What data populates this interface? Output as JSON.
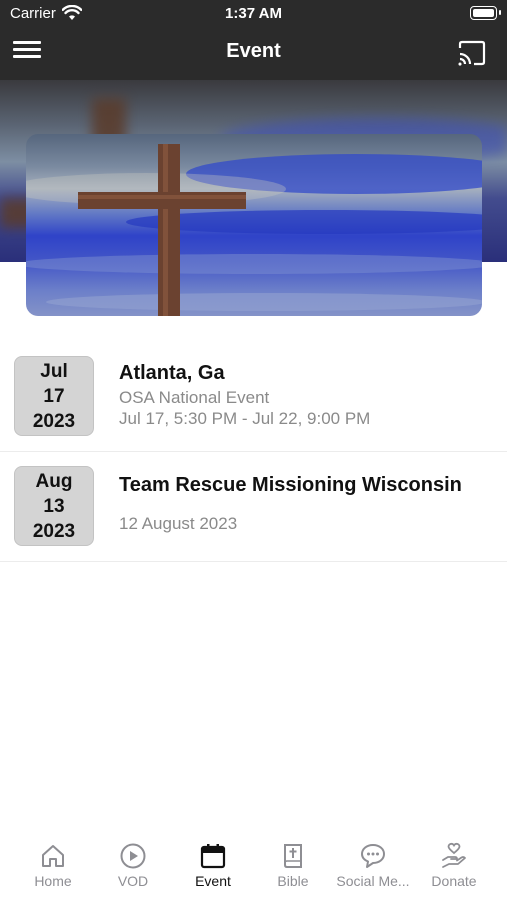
{
  "status_bar": {
    "carrier": "Carrier",
    "time": "1:37 AM"
  },
  "nav": {
    "title": "Event"
  },
  "events": [
    {
      "month": "Jul",
      "day": "17",
      "year": "2023",
      "title": "Atlanta, Ga",
      "subtitle": "OSA National Event",
      "time": "Jul 17, 5:30 PM - Jul 22, 9:00 PM"
    },
    {
      "month": "Aug",
      "day": "13",
      "year": "2023",
      "title": "Team Rescue Missioning Wisconsin",
      "time": "12 August 2023"
    }
  ],
  "tabs": [
    {
      "label": "Home",
      "icon": "home-icon"
    },
    {
      "label": "VOD",
      "icon": "play-circle-icon"
    },
    {
      "label": "Event",
      "icon": "calendar-icon",
      "active": true
    },
    {
      "label": "Bible",
      "icon": "bible-icon"
    },
    {
      "label": "Social Me...",
      "icon": "chat-bubble-icon"
    },
    {
      "label": "Donate",
      "icon": "donate-hand-icon"
    }
  ],
  "colors": {
    "header_bg": "#2b2b2b",
    "date_box_bg": "#d4d4d4",
    "muted_text": "#8a8a8a",
    "tab_inactive": "#8e8e93"
  }
}
